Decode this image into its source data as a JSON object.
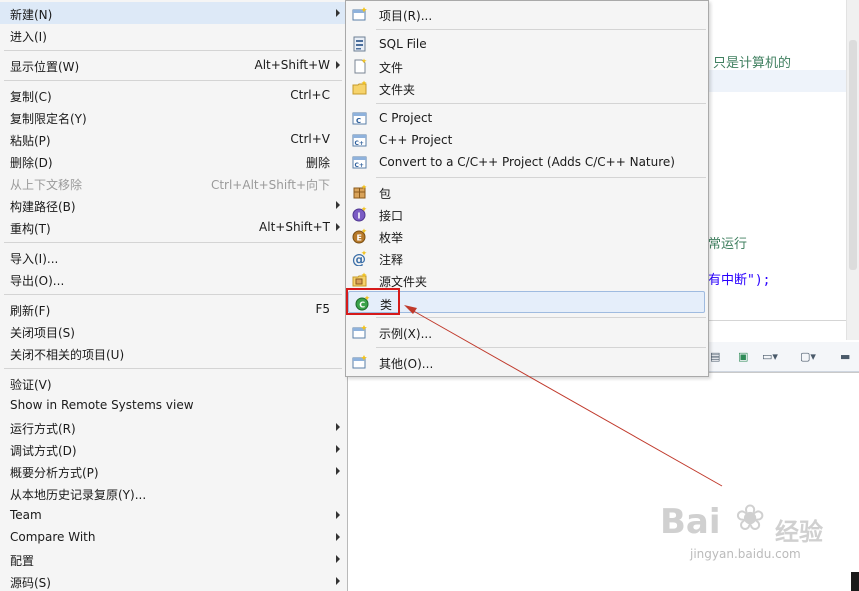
{
  "editor": {
    "line1": "只是计算机的",
    "line2": "常运行",
    "line3": "有中断\");"
  },
  "context_menu": {
    "items": [
      {
        "label": "新建(N)",
        "shortcut": "",
        "submenu": true
      },
      {
        "label": "进入(I)",
        "shortcut": "",
        "submenu": false
      },
      {
        "label": "显示位置(W)",
        "shortcut": "Alt+Shift+W",
        "submenu": true
      },
      {
        "label": "复制(C)",
        "shortcut": "Ctrl+C",
        "submenu": false
      },
      {
        "label": "复制限定名(Y)",
        "shortcut": "",
        "submenu": false
      },
      {
        "label": "粘贴(P)",
        "shortcut": "Ctrl+V",
        "submenu": false
      },
      {
        "label": "删除(D)",
        "shortcut": "删除",
        "submenu": false
      },
      {
        "label": "从上下文移除",
        "shortcut": "Ctrl+Alt+Shift+向下",
        "submenu": false,
        "disabled": true
      },
      {
        "label": "构建路径(B)",
        "shortcut": "",
        "submenu": true
      },
      {
        "label": "重构(T)",
        "shortcut": "Alt+Shift+T",
        "submenu": true
      },
      {
        "label": "导入(I)...",
        "shortcut": "",
        "submenu": false
      },
      {
        "label": "导出(O)...",
        "shortcut": "",
        "submenu": false
      },
      {
        "label": "刷新(F)",
        "shortcut": "F5",
        "submenu": false
      },
      {
        "label": "关闭项目(S)",
        "shortcut": "",
        "submenu": false
      },
      {
        "label": "关闭不相关的项目(U)",
        "shortcut": "",
        "submenu": false
      },
      {
        "label": "验证(V)",
        "shortcut": "",
        "submenu": false
      },
      {
        "label": "Show in Remote Systems view",
        "shortcut": "",
        "submenu": false
      },
      {
        "label": "运行方式(R)",
        "shortcut": "",
        "submenu": true
      },
      {
        "label": "调试方式(D)",
        "shortcut": "",
        "submenu": true
      },
      {
        "label": "概要分析方式(P)",
        "shortcut": "",
        "submenu": true
      },
      {
        "label": "从本地历史记录复原(Y)...",
        "shortcut": "",
        "submenu": false
      },
      {
        "label": "Team",
        "shortcut": "",
        "submenu": true
      },
      {
        "label": "Compare With",
        "shortcut": "",
        "submenu": true
      },
      {
        "label": "配置",
        "shortcut": "",
        "submenu": true
      },
      {
        "label": "源码(S)",
        "shortcut": "",
        "submenu": true
      }
    ]
  },
  "new_submenu": {
    "items": [
      {
        "label": "项目(R)...",
        "icon": "new-project-icon"
      },
      {
        "label": "SQL File",
        "icon": "sql-file-icon"
      },
      {
        "label": "文件",
        "icon": "new-file-icon"
      },
      {
        "label": "文件夹",
        "icon": "new-folder-icon"
      },
      {
        "label": "C Project",
        "icon": "c-project-icon"
      },
      {
        "label": "C++ Project",
        "icon": "cpp-project-icon"
      },
      {
        "label": "Convert to a C/C++ Project (Adds C/C++ Nature)",
        "icon": "convert-cpp-icon"
      },
      {
        "label": "包",
        "icon": "package-icon"
      },
      {
        "label": "接口",
        "icon": "interface-icon"
      },
      {
        "label": "枚举",
        "icon": "enum-icon"
      },
      {
        "label": "注释",
        "icon": "annotation-icon"
      },
      {
        "label": "源文件夹",
        "icon": "source-folder-icon"
      },
      {
        "label": "类",
        "icon": "class-icon"
      },
      {
        "label": "示例(X)...",
        "icon": "example-icon"
      },
      {
        "label": "其他(O)...",
        "icon": "other-icon"
      }
    ]
  },
  "watermark": {
    "logo": "Bai",
    "logo_cn": "经验",
    "url": "jingyan.baidu.com"
  },
  "colors": {
    "highlight_box": "#d61a1a",
    "annotation_arrow": "#c0392b",
    "hover_bg": "#e5eefa"
  }
}
